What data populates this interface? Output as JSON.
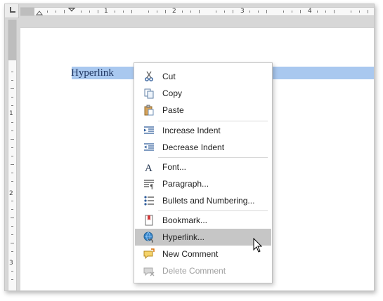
{
  "document": {
    "text": "Hyperlink"
  },
  "ruler": {
    "corner_icon": "tab-stop-left-icon",
    "horizontal_numbers": [
      "1",
      "2",
      "3",
      "4"
    ],
    "vertical_numbers": [
      "1",
      "2",
      "3"
    ]
  },
  "context_menu": {
    "items": [
      {
        "label": "Cut",
        "icon": "scissors-icon",
        "enabled": true
      },
      {
        "label": "Copy",
        "icon": "copy-icon",
        "enabled": true
      },
      {
        "label": "Paste",
        "icon": "paste-icon",
        "enabled": true
      },
      {
        "label": "Increase Indent",
        "icon": "increase-indent-icon",
        "enabled": true
      },
      {
        "label": "Decrease Indent",
        "icon": "decrease-indent-icon",
        "enabled": true
      },
      {
        "label": "Font...",
        "icon": "font-icon",
        "enabled": true
      },
      {
        "label": "Paragraph...",
        "icon": "paragraph-icon",
        "enabled": true
      },
      {
        "label": "Bullets and Numbering...",
        "icon": "bullets-numbering-icon",
        "enabled": true
      },
      {
        "label": "Bookmark...",
        "icon": "bookmark-icon",
        "enabled": true
      },
      {
        "label": "Hyperlink...",
        "icon": "hyperlink-icon",
        "enabled": true,
        "highlighted": true
      },
      {
        "label": "New Comment",
        "icon": "new-comment-icon",
        "enabled": true
      },
      {
        "label": "Delete Comment",
        "icon": "delete-comment-icon",
        "enabled": false
      }
    ]
  },
  "colors": {
    "selection": "#a9c8ef",
    "menu_highlight": "#c6c6c6",
    "disabled_text": "#a0a0a0"
  }
}
